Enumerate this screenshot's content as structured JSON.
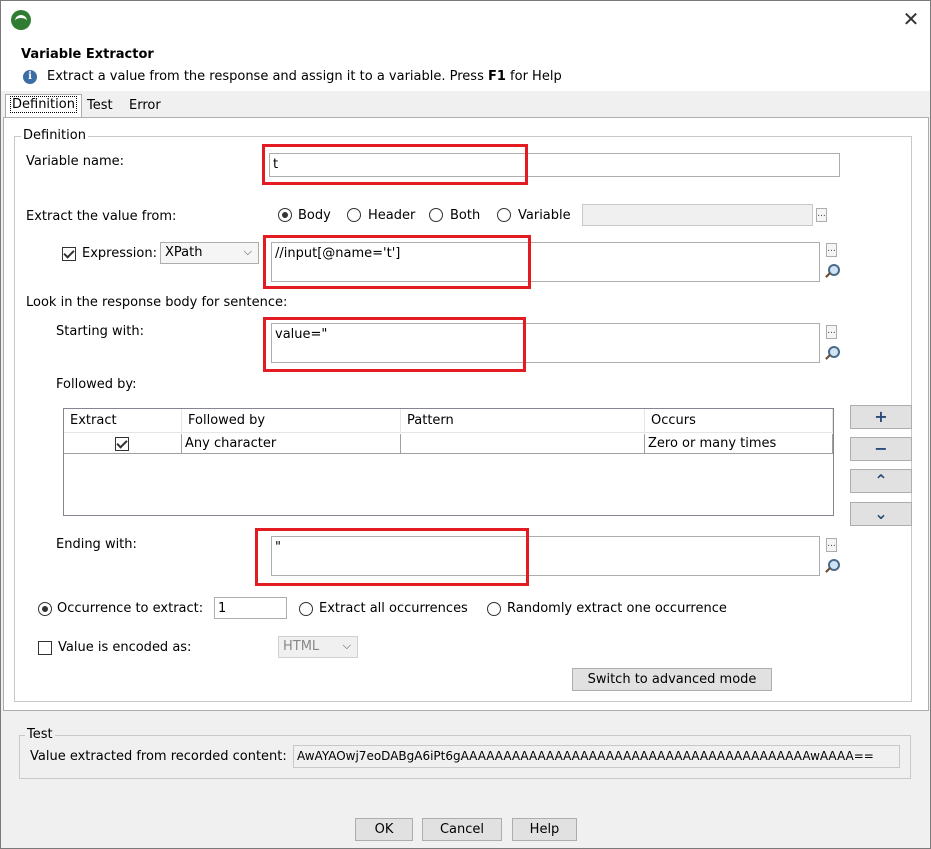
{
  "window": {
    "title": "Variable Extractor",
    "description_prefix": "Extract a value from the response and assign it to a variable. Press ",
    "description_key": "F1",
    "description_suffix": " for Help"
  },
  "tabs": [
    {
      "label": "Definition",
      "active": true
    },
    {
      "label": "Test"
    },
    {
      "label": "Error"
    }
  ],
  "definition": {
    "group_label": "Definition",
    "variable_name_label": "Variable name:",
    "variable_name_value": "t",
    "extract_from_label": "Extract the value from:",
    "extract_from_options": [
      "Body",
      "Header",
      "Both",
      "Variable"
    ],
    "extract_from_selected": "Body",
    "variable_field_value": "",
    "expression_label": "Expression:",
    "expression_checked": true,
    "expression_type": "XPath",
    "expression_value": "//input[@name='t']",
    "look_in_label": "Look in the response body for sentence:",
    "starting_with_label": "Starting with:",
    "starting_with_value": "value=\"",
    "followed_by_label": "Followed by:",
    "table": {
      "columns": [
        "Extract",
        "Followed by",
        "Pattern",
        "Occurs"
      ],
      "rows": [
        {
          "extract": true,
          "followed_by": "Any character",
          "pattern": "",
          "occurs": "Zero or many times"
        }
      ]
    },
    "side_buttons": [
      "+",
      "−",
      "⌃",
      "⌄"
    ],
    "ending_with_label": "Ending with:",
    "ending_with_value": "\"",
    "occurrence_label": "Occurrence to extract:",
    "occurrence_value": "1",
    "extract_all_label": "Extract all occurrences",
    "random_label": "Randomly extract one occurrence",
    "encoded_label": "Value is encoded as:",
    "encoded_checked": false,
    "encoded_value": "HTML",
    "advanced_button": "Switch to advanced mode"
  },
  "test": {
    "group_label": "Test",
    "value_label": "Value extracted from recorded content:",
    "value": "AwAYAOwj7eoDABgA6iPt6gAAAAAAAAAAAAAAAAAAAAAAAAAAAAAAAAAAAAAAAAAwAAAA=="
  },
  "footer": {
    "ok": "OK",
    "cancel": "Cancel",
    "help": "Help"
  },
  "colors": {
    "highlight": "#e31b23",
    "background": "#f0f0f0"
  }
}
